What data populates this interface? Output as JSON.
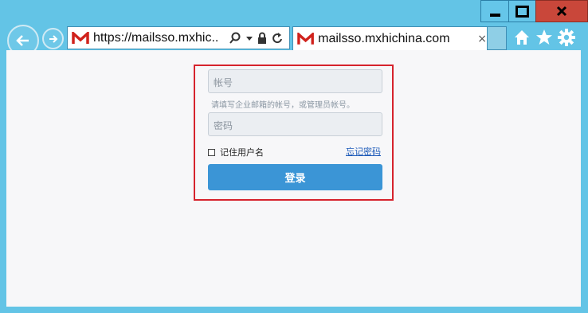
{
  "browser": {
    "address_url": "https://mailsso.mxhic...",
    "tab_title": "mailsso.mxhichina.com",
    "tab_close": "×",
    "favicon_letter": "M",
    "colors": {
      "frame": "#63c4e6",
      "close": "#c9473a",
      "favicon": "#d0221c"
    }
  },
  "login": {
    "account_placeholder": "帐号",
    "hint": "请填写企业邮箱的帐号，或管理员帐号。",
    "password_placeholder": "密码",
    "remember_label": "记住用户名",
    "forgot_label": "忘记密码",
    "submit_label": "登录",
    "colors": {
      "button": "#3b95d6",
      "highlight_border": "#d6232d",
      "link": "#1a58b8"
    }
  }
}
